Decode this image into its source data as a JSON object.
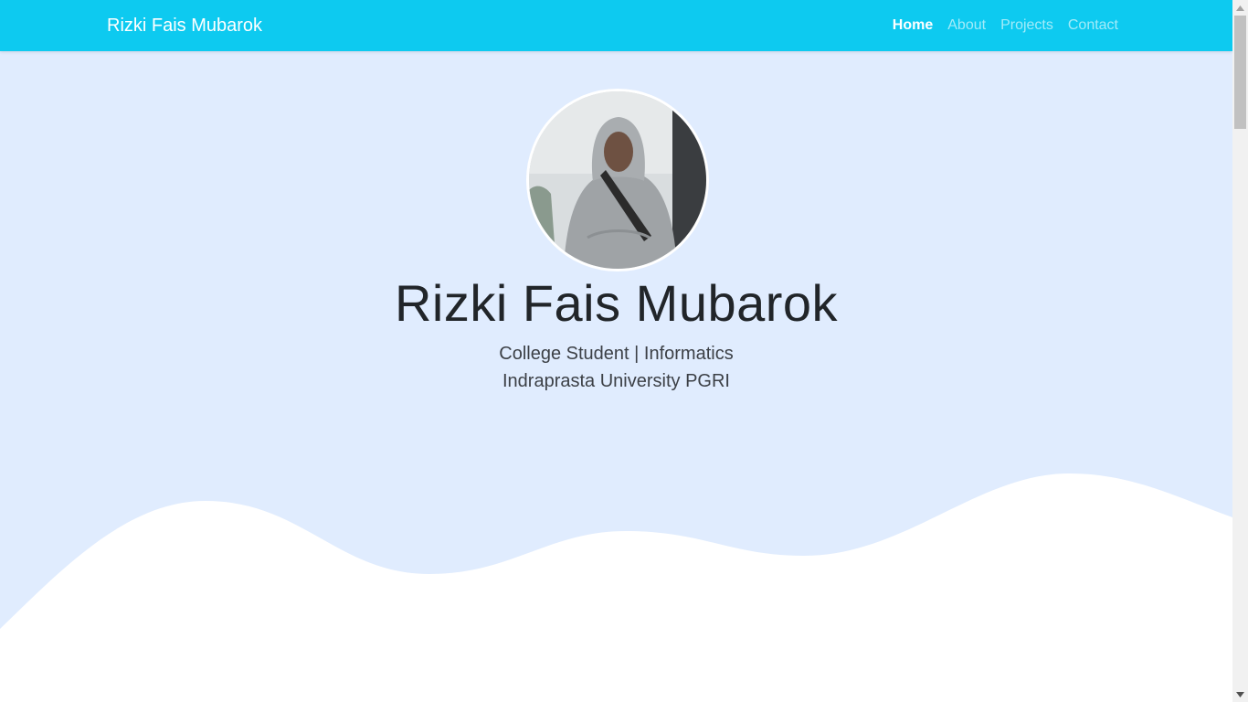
{
  "navbar": {
    "brand": "Rizki Fais Mubarok",
    "items": [
      {
        "label": "Home",
        "active": true
      },
      {
        "label": "About",
        "active": false
      },
      {
        "label": "Projects",
        "active": false
      },
      {
        "label": "Contact",
        "active": false
      }
    ]
  },
  "hero": {
    "title": "Rizki Fais Mubarok",
    "subtitle_line1": "College Student | Informatics",
    "subtitle_line2": "Indraprasta University PGRI"
  },
  "colors": {
    "navbar_bg": "#0dcaf0",
    "hero_bg": "#e0ecfe",
    "wave_fill": "#ffffff"
  }
}
